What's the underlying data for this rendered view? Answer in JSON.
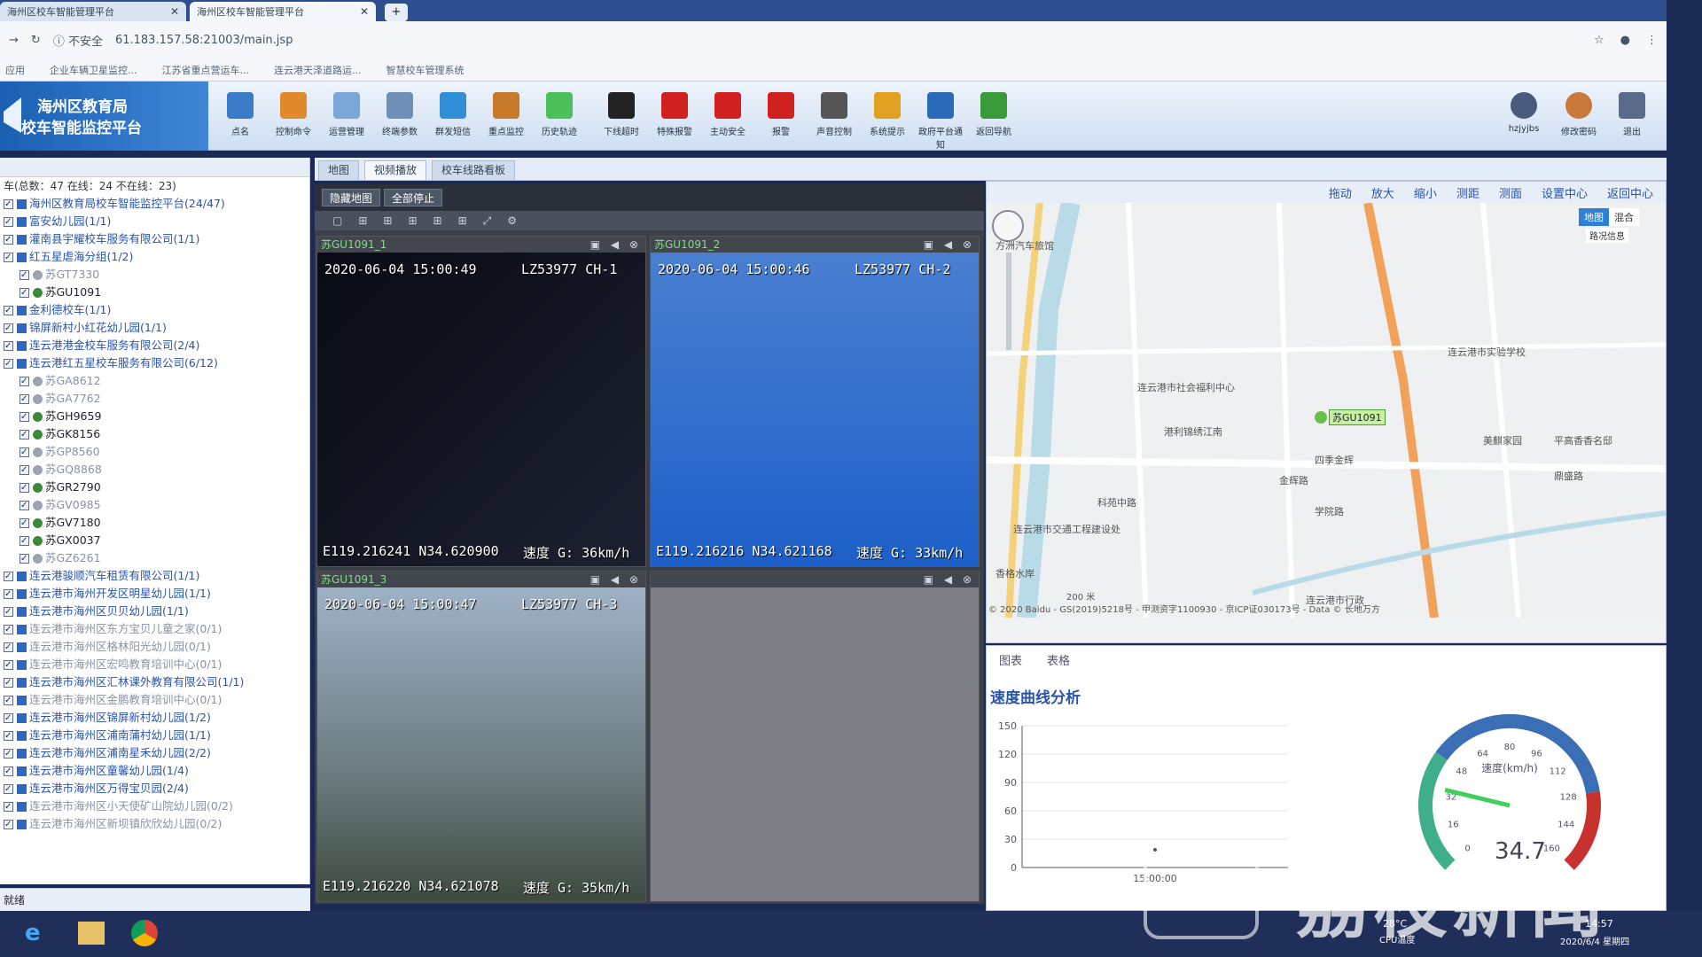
{
  "browser": {
    "tabs": [
      {
        "title": "海州区校车智能管理平台"
      },
      {
        "title": "海州区校车智能管理平台"
      }
    ],
    "security": "不安全",
    "url": "61.183.157.58:21003/main.jsp",
    "bookmarks": [
      "应用",
      "企业车辆卫星监控...",
      "江苏省重点营运车...",
      "连云港天泽道路运...",
      "智慧校车管理系统"
    ]
  },
  "app": {
    "title_line1": "海州区教育局",
    "title_line2": "校车智能监控平台",
    "toolbar": [
      {
        "label": "点名",
        "color": "#3a7cc8"
      },
      {
        "label": "控制命令",
        "color": "#e08a2c"
      },
      {
        "label": "运营管理",
        "color": "#7aa6d8"
      },
      {
        "label": "终端参数",
        "color": "#6d8fb8"
      },
      {
        "label": "群发短信",
        "color": "#2f8ed6"
      },
      {
        "label": "重点监控",
        "color": "#c77a2a"
      },
      {
        "label": "历史轨迹",
        "color": "#4bbf5a"
      },
      {
        "label": "下线超时",
        "color": "#222222"
      },
      {
        "label": "特殊报警",
        "color": "#d02020"
      },
      {
        "label": "主动安全",
        "color": "#d02020"
      },
      {
        "label": "报警",
        "color": "#d02020"
      },
      {
        "label": "声音控制",
        "color": "#555555"
      },
      {
        "label": "系统提示",
        "color": "#e0a020"
      },
      {
        "label": "政府平台通知",
        "color": "#2a6ab8"
      },
      {
        "label": "返回导航",
        "color": "#3a9a3a"
      }
    ],
    "user": {
      "name": "hzjyjbs",
      "change_pwd": "修改密码",
      "logout": "退出"
    }
  },
  "tree": {
    "summary": "车(总数：47 在线：24 不在线：23)",
    "root": "海州区教育局校车智能监控平台(24/47)",
    "items": [
      {
        "text": "富安幼儿园(1/1)",
        "type": "org"
      },
      {
        "text": "灌南县宇耀校车服务有限公司(1/1)",
        "type": "org"
      },
      {
        "text": "红五星虐海分组(1/2)",
        "type": "org"
      },
      {
        "text": "苏GT7330",
        "type": "veh",
        "state": "grey"
      },
      {
        "text": "苏GU1091",
        "type": "veh",
        "state": "on"
      },
      {
        "text": "金利德校车(1/1)",
        "type": "org"
      },
      {
        "text": "锦屏新村小红花幼儿园(1/1)",
        "type": "org"
      },
      {
        "text": "连云港港金校车服务有限公司(2/4)",
        "type": "org"
      },
      {
        "text": "连云港红五星校车服务有限公司(6/12)",
        "type": "org"
      },
      {
        "text": "苏GA8612",
        "type": "veh",
        "state": "grey"
      },
      {
        "text": "苏GA7762",
        "type": "veh",
        "state": "grey"
      },
      {
        "text": "苏GH9659",
        "type": "veh",
        "state": "on"
      },
      {
        "text": "苏GK8156",
        "type": "veh",
        "state": "on"
      },
      {
        "text": "苏GP8560",
        "type": "veh",
        "state": "grey"
      },
      {
        "text": "苏GQ8868",
        "type": "veh",
        "state": "grey"
      },
      {
        "text": "苏GR2790",
        "type": "veh",
        "state": "on"
      },
      {
        "text": "苏GV0985",
        "type": "veh",
        "state": "grey"
      },
      {
        "text": "苏GV7180",
        "type": "veh",
        "state": "on"
      },
      {
        "text": "苏GX0037",
        "type": "veh",
        "state": "on"
      },
      {
        "text": "苏GZ6261",
        "type": "veh",
        "state": "grey"
      },
      {
        "text": "连云港骏顺汽车租赁有限公司(1/1)",
        "type": "org"
      },
      {
        "text": "连云港市海州开发区明星幼儿园(1/1)",
        "type": "org"
      },
      {
        "text": "连云港市海州区贝贝幼儿园(1/1)",
        "type": "org"
      },
      {
        "text": "连云港市海州区东方宝贝儿童之家(0/1)",
        "type": "org-grey"
      },
      {
        "text": "连云港市海州区格林阳光幼儿园(0/1)",
        "type": "org-grey"
      },
      {
        "text": "连云港市海州区宏鸣教育培训中心(0/1)",
        "type": "org-grey"
      },
      {
        "text": "连云港市海州区汇林课外教育有限公司(1/1)",
        "type": "org"
      },
      {
        "text": "连云港市海州区金鹏教育培训中心(0/1)",
        "type": "org-grey"
      },
      {
        "text": "连云港市海州区锦屏新村幼儿园(1/2)",
        "type": "org"
      },
      {
        "text": "连云港市海州区浦南蒲村幼儿园(1/1)",
        "type": "org"
      },
      {
        "text": "连云港市海州区浦南星禾幼儿园(2/2)",
        "type": "org"
      },
      {
        "text": "连云港市海州区童馨幼儿园(1/4)",
        "type": "org"
      },
      {
        "text": "连云港市海州区万得宝贝园(2/4)",
        "type": "org"
      },
      {
        "text": "连云港市海州区小天使矿山院幼儿园(0/2)",
        "type": "org-grey"
      },
      {
        "text": "连云港市海州区新坝镇欣欣幼儿园(0/2)",
        "type": "org-grey"
      }
    ],
    "status": "就绪"
  },
  "content_tabs": [
    "地图",
    "视频播放",
    "校车线路看板"
  ],
  "video": {
    "hide_map": "隐藏地图",
    "stop_all": "全部停止",
    "cells": [
      {
        "title": "苏GU1091_1",
        "time": "2020-06-04 15:00:49",
        "plate": "LZ53977 CH-1",
        "gps": "E119.216241 N34.620900",
        "speed": "速度 G: 36km/h"
      },
      {
        "title": "苏GU1091_2",
        "time": "2020-06-04 15:00:46",
        "plate": "LZ53977 CH-2",
        "gps": "E119.216216 N34.621168",
        "speed": "速度 G: 33km/h"
      },
      {
        "title": "苏GU1091_3",
        "time": "2020-06-04 15:00:47",
        "plate": "LZ53977 CH-3",
        "gps": "E119.216220 N34.621078",
        "speed": "速度 G: 35km/h"
      },
      {
        "title": "",
        "time": "",
        "plate": "",
        "gps": "",
        "speed": ""
      }
    ]
  },
  "map": {
    "toolbar": [
      "拖动",
      "放大",
      "缩小",
      "测距",
      "测面",
      "设置中心",
      "返回中心"
    ],
    "type_buttons": [
      "地图",
      "混合"
    ],
    "traffic": "路况信息",
    "vehicle_label": "苏GU1091",
    "places": [
      "连云港市社会福利中心",
      "连云港市实验学校",
      "港利锦绣江南",
      "四季金辉",
      "金辉路",
      "美麒家园",
      "平高香香名邸",
      "连云港市交通工程建设处",
      "连云港市行政",
      "鼎盛路",
      "科苑中路",
      "学院路",
      "香格水岸",
      "方洲汽车旅馆"
    ],
    "copyright": "© 2020 Baidu - GS(2019)5218号 - 甲测资字1100930 - 京ICP证030173号 - Data © 长地万方",
    "scale": "200 米"
  },
  "analysis": {
    "tabs": [
      "图表",
      "表格"
    ],
    "title": "速度曲线分析",
    "yticks": [
      "150",
      "120",
      "90",
      "60",
      "30",
      "0"
    ],
    "xtick": "15:00:00",
    "gauge_unit": "速度(km/h)",
    "gauge_value": "34.7",
    "gauge_ticks": [
      "0",
      "16",
      "32",
      "48",
      "64",
      "80",
      "96",
      "112",
      "128",
      "144",
      "160"
    ]
  },
  "taskbar": {
    "temp": "28°C",
    "temp_label": "CPU温度",
    "time": "14:57",
    "date": "2020/6/4 星期四"
  },
  "watermark": "荔枝新闻"
}
